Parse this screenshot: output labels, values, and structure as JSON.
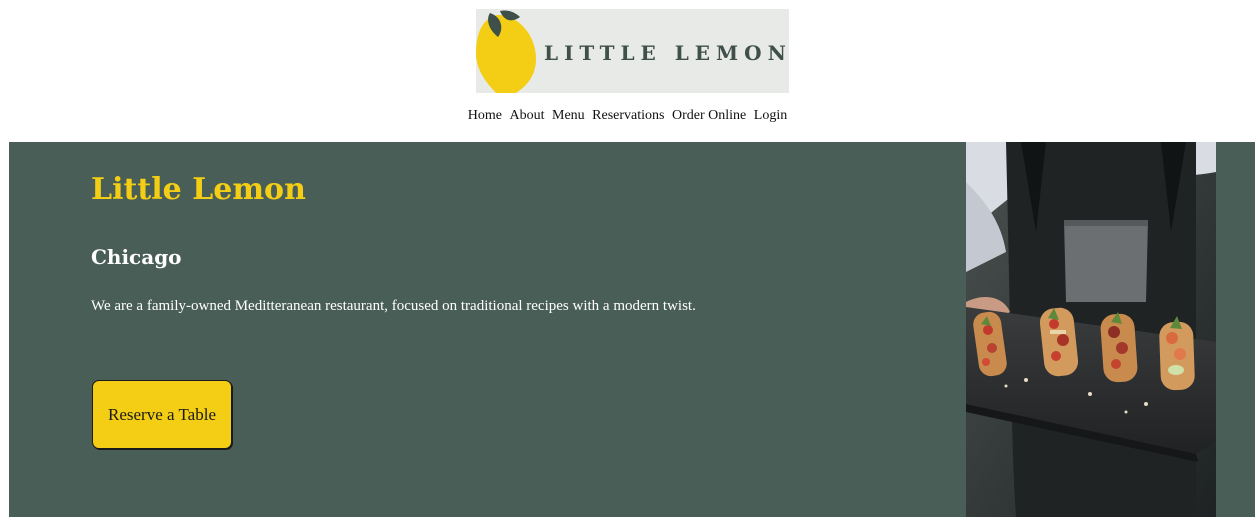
{
  "header": {
    "logo": {
      "text": "LITTLE LEMON",
      "icon": "lemon-icon",
      "colors": {
        "lemon": "#f4ce14",
        "leaf": "#3f4f49",
        "background": "#e8eae8"
      }
    },
    "nav": [
      {
        "label": "Home"
      },
      {
        "label": "About"
      },
      {
        "label": "Menu"
      },
      {
        "label": "Reservations"
      },
      {
        "label": "Order Online"
      },
      {
        "label": "Login"
      }
    ]
  },
  "hero": {
    "title": "Little Lemon",
    "subtitle": "Chicago",
    "description": "We are a family-owned Meditteranean restaurant, focused on traditional recipes with a modern twist.",
    "cta_label": "Reserve a Table",
    "image": "waiter-serving-bruschetta-photo",
    "colors": {
      "background": "#495e57",
      "accent": "#f4ce14",
      "text": "#ffffff"
    }
  }
}
